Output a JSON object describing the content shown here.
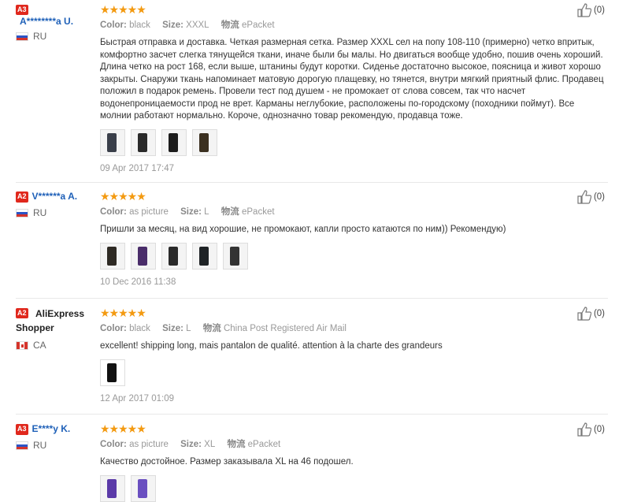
{
  "reviews": [
    {
      "badge": "A3",
      "name": "A********a U.",
      "country": "RU",
      "rating": "★★★★★",
      "color_label": "Color:",
      "color_value": "black",
      "size_label": "Size:",
      "size_value": "XXXL",
      "ship_label": "物流",
      "ship_value": "ePacket",
      "text": "Быстрая отправка и доставка. Четкая размерная сетка. Размер XXXL сел на попу 108-110 (примерно) четко впритык, комфортно засчет слегка тянущейся ткани, иначе были бы малы. Но двигаться вообще удобно, пошив очень хороший. Длина четко на рост 168, если выше, штанины будут коротки. Сиденье достаточно высокое, поясница и живот хорошо закрыты. Снаружи ткань напоминает матовую дорогую плащевку, но тянется, внутри мягкий приятный флис. Продавец положил в подарок ремень. Провели тест под душем - не промокает от слова совсем, так что насчет водонепроницаемости прод не врет. Карманы неглубокие, расположены по-городскому (походники поймут). Все молнии работают нормально. Короче, однозначно товар рекомендую, продавца тоже.",
      "date": "09 Apr 2017 17:47",
      "likes": "(0)",
      "thumb_colors": [
        "#3a3f4a",
        "#2a2a2a",
        "#1c1c1c",
        "#3b3020"
      ]
    },
    {
      "badge": "A2",
      "name": "V******a A.",
      "country": "RU",
      "rating": "★★★★★",
      "color_label": "Color:",
      "color_value": "as picture",
      "size_label": "Size:",
      "size_value": "L",
      "ship_label": "物流",
      "ship_value": "ePacket",
      "text": "Пришли за месяц, на вид хорошие, не промокают, капли просто катаются по ним)) Рекомендую)",
      "date": "10 Dec 2016 11:38",
      "likes": "(0)",
      "thumb_colors": [
        "#2e2a24",
        "#4a2d6a",
        "#2a2a2a",
        "#1f2326",
        "#333333"
      ]
    },
    {
      "badge": "A2",
      "name": "AliExpress Shopper",
      "country": "CA",
      "rating": "★★★★★",
      "color_label": "Color:",
      "color_value": "black",
      "size_label": "Size:",
      "size_value": "L",
      "ship_label": "物流",
      "ship_value": "China Post Registered Air Mail",
      "text": "excellent! shipping long, mais pantalon de qualité. attention à la charte des grandeurs",
      "date": "12 Apr 2017 01:09",
      "likes": "(0)",
      "thumb_colors": [
        "#111111"
      ]
    },
    {
      "badge": "A3",
      "name": "E****y K.",
      "country": "RU",
      "rating": "★★★★★",
      "color_label": "Color:",
      "color_value": "as picture",
      "size_label": "Size:",
      "size_value": "XL",
      "ship_label": "物流",
      "ship_value": "ePacket",
      "text": "Качество достойное. Размер заказывала XL на 46 подошел.",
      "date": "",
      "likes": "(0)",
      "thumb_colors": [
        "#5b3aa8",
        "#6a4fc0"
      ]
    }
  ]
}
